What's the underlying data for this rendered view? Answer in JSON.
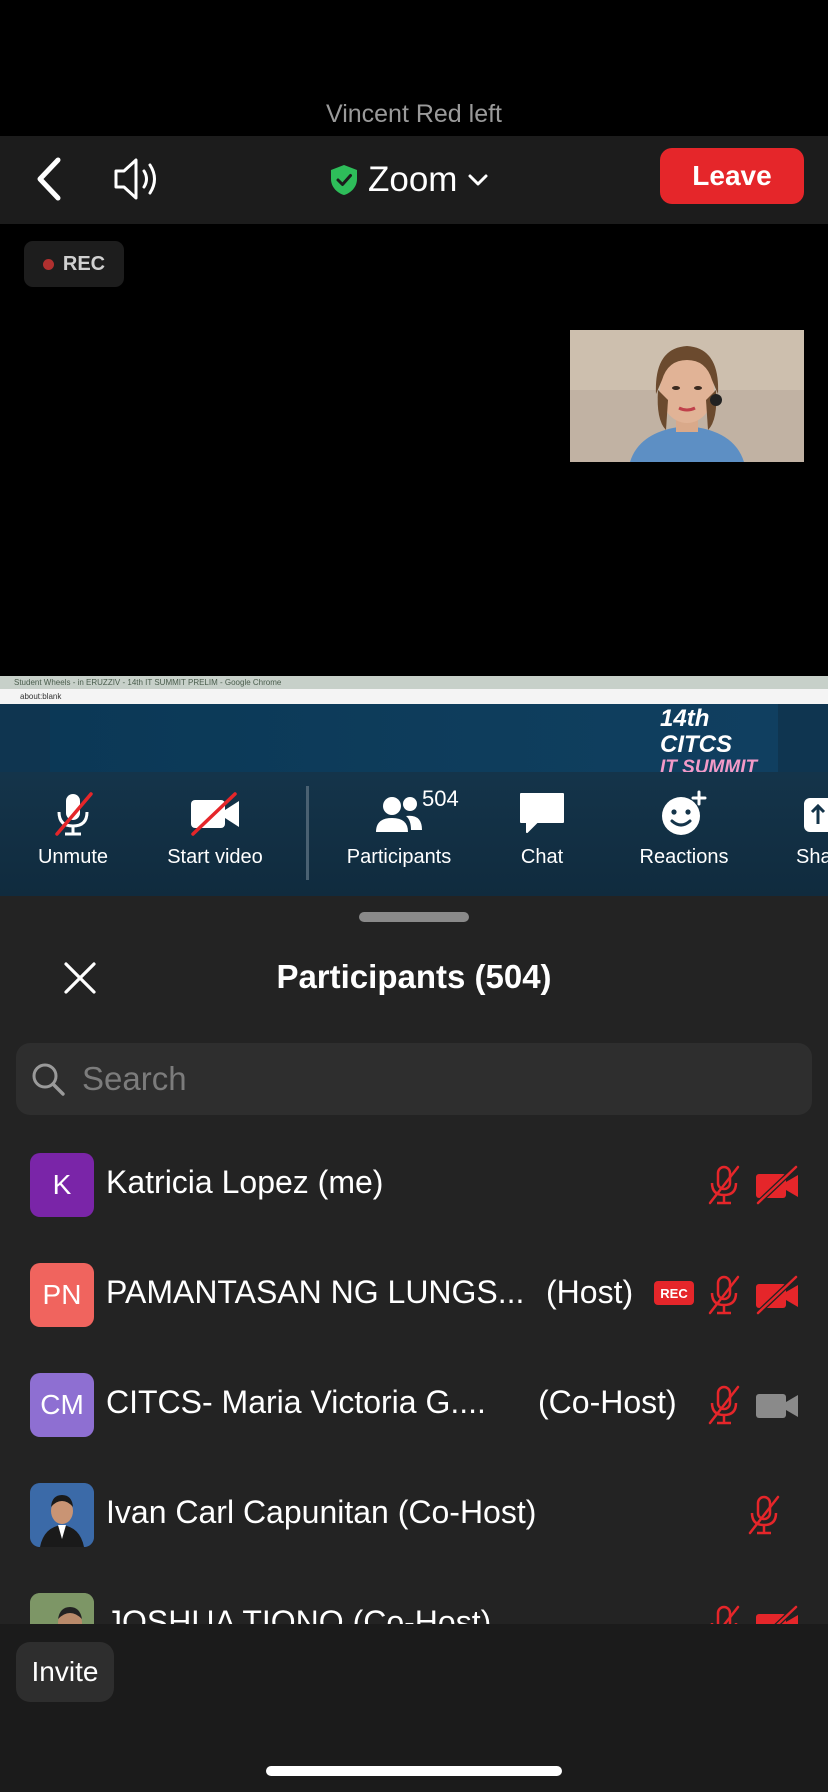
{
  "notice": "Vincent Red left",
  "topbar": {
    "title": "Zoom",
    "leave_label": "Leave"
  },
  "recording": {
    "label": "REC"
  },
  "screen_share": {
    "window_title": "Student Wheels - in ERUZZIV - 14th IT SUMMIT PRELIM - Google Chrome",
    "address": "about:blank",
    "logo_line1": "14th CITCS",
    "logo_line2": "IT SUMMIT"
  },
  "toolbar": {
    "unmute": "Unmute",
    "start_video": "Start video",
    "participants": "Participants",
    "participants_count": "504",
    "chat": "Chat",
    "reactions": "Reactions",
    "share": "Sha"
  },
  "panel": {
    "title": "Participants (504)",
    "search_placeholder": "Search",
    "invite_label": "Invite"
  },
  "participants": [
    {
      "initials": "K",
      "name": "Katricia Lopez (me)",
      "role": "",
      "avatar_color": "#7a25a8",
      "rec": false,
      "mic": "muted",
      "video": "off"
    },
    {
      "initials": "PN",
      "name": "PAMANTASAN NG LUNGS...",
      "role": "(Host)",
      "avatar_color": "#f0645e",
      "rec": true,
      "rec_label": "REC",
      "mic": "muted",
      "video": "off"
    },
    {
      "initials": "CM",
      "name": "CITCS- Maria Victoria G....",
      "role": "(Co-Host)",
      "avatar_color": "#8e6fd2",
      "rec": false,
      "mic": "muted",
      "video": "on"
    },
    {
      "initials": "",
      "name": "Ivan Carl Capunitan (Co-Host)",
      "role": "",
      "avatar_color": "#2f4a7a",
      "rec": false,
      "mic": "muted",
      "video": "none"
    },
    {
      "initials": "",
      "name": "JOSHUA TIONO (Co-Host)",
      "role": "",
      "avatar_color": "#6f8a5a",
      "rec": false,
      "mic": "muted",
      "video": "off"
    }
  ],
  "colors": {
    "leave": "#e5262a",
    "muted_red": "#e5262a",
    "shield_green": "#2ebd5a"
  }
}
